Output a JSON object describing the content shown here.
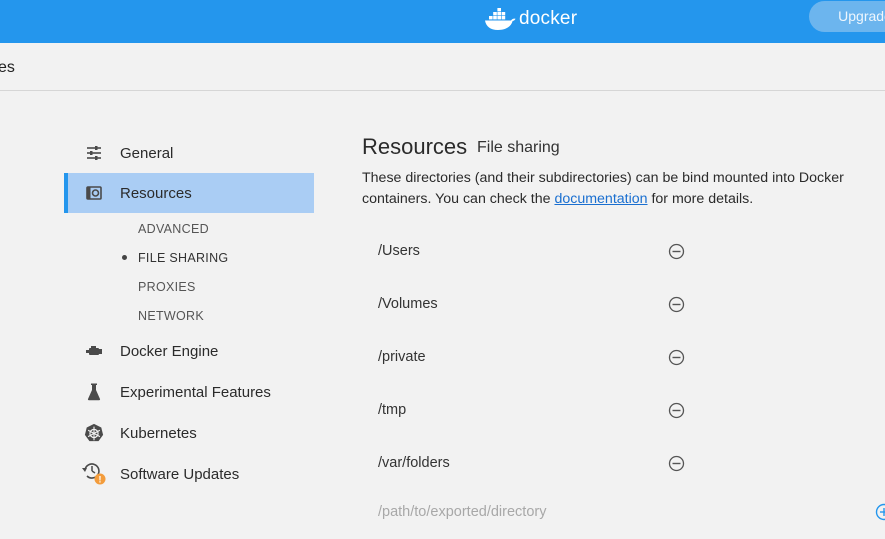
{
  "header": {
    "logo_text": "docker",
    "upgrade_label": "Upgrade",
    "brand_color": "#2496ed"
  },
  "titlebar": {
    "title_fragment": "es"
  },
  "sidebar": {
    "items": [
      {
        "label": "General",
        "icon": "sliders-icon"
      },
      {
        "label": "Resources",
        "icon": "resources-icon",
        "active": true
      },
      {
        "label": "Docker Engine",
        "icon": "engine-icon"
      },
      {
        "label": "Experimental Features",
        "icon": "flask-icon"
      },
      {
        "label": "Kubernetes",
        "icon": "kubernetes-icon"
      },
      {
        "label": "Software Updates",
        "icon": "updates-icon",
        "badge": "!"
      }
    ],
    "subitems": [
      {
        "label": "ADVANCED"
      },
      {
        "label": "FILE SHARING",
        "current": true
      },
      {
        "label": "PROXIES"
      },
      {
        "label": "NETWORK"
      }
    ]
  },
  "main": {
    "title": "Resources",
    "subtitle": "File sharing",
    "description_before": "These directories (and their subdirectories) can be bind mounted into Docker containers. You can check the ",
    "link_text": "documentation",
    "description_after": " for more details.",
    "directories": [
      "/Users",
      "/Volumes",
      "/private",
      "/tmp",
      "/var/folders"
    ],
    "input_placeholder": "/path/to/exported/directory",
    "input_value": ""
  }
}
